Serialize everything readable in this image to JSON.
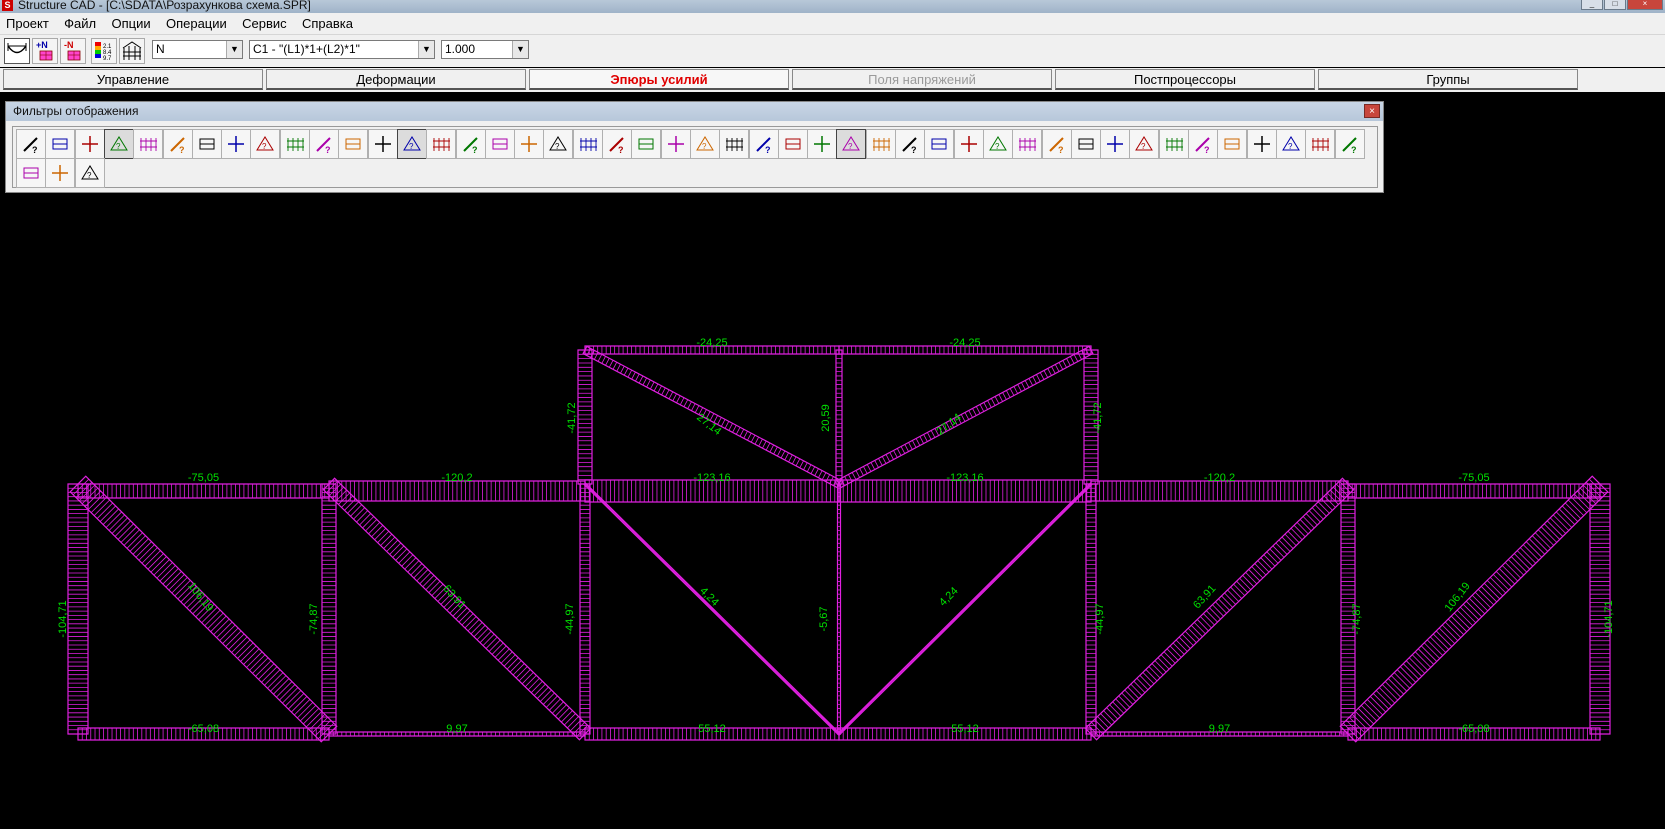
{
  "window": {
    "title": "Structure CAD  - [C:\\SDATA\\Розрахункова схема.SPR]",
    "minimize": "_",
    "maximize": "□",
    "close": "×"
  },
  "menu": [
    "Проект",
    "Файл",
    "Опции",
    "Операции",
    "Сервис",
    "Справка"
  ],
  "toolbar": {
    "force_component": "N",
    "load_combination": "С1 - \"(L1)*1+(L2)*1\"",
    "scale": "1.000"
  },
  "tabs": [
    {
      "label": "Управление",
      "state": "normal"
    },
    {
      "label": "Деформации",
      "state": "normal"
    },
    {
      "label": "Эпюры усилий",
      "state": "active"
    },
    {
      "label": "Поля напряжений",
      "state": "disabled"
    },
    {
      "label": "Постпроцессоры",
      "state": "normal"
    },
    {
      "label": "Группы",
      "state": "normal"
    }
  ],
  "filter_panel": {
    "title": "Фильтры отображения",
    "close": "×",
    "row1_button_count": 46,
    "row2_button_count": 3
  },
  "colors": {
    "background": "#000000",
    "diagram": "#e020e0",
    "labels": "#00e000",
    "active_tab": "#e00000"
  },
  "diagram_labels": {
    "top_chord_left": "-24,25",
    "top_chord_right": "-24,25",
    "upper_diag_left": "27,14",
    "upper_diag_right": "27,14",
    "upper_post_left": "-41,72",
    "upper_post_center": "20,59",
    "upper_post_right": "-41,72",
    "mid_chord_1": "-75,05",
    "mid_chord_2": "-120,2",
    "mid_chord_3": "-123,16",
    "mid_chord_4": "-123,16",
    "mid_chord_5": "-120,2",
    "mid_chord_6": "-75,05",
    "post_1": "-104,71",
    "post_2": "-74,87",
    "post_3": "-44,97",
    "post_4": "-5,67",
    "post_5": "-44,97",
    "post_6": "-74,87",
    "post_7": "-104,71",
    "diag_1": "106,19",
    "diag_2": "63,91",
    "diag_3": "4,24",
    "diag_4": "4,24",
    "diag_5": "63,91",
    "diag_6": "106,19",
    "bottom_chord_1": "-65,08",
    "bottom_chord_2": "9,97",
    "bottom_chord_3": "55,12",
    "bottom_chord_4": "55,12",
    "bottom_chord_5": "9,97",
    "bottom_chord_6": "-65,08"
  }
}
